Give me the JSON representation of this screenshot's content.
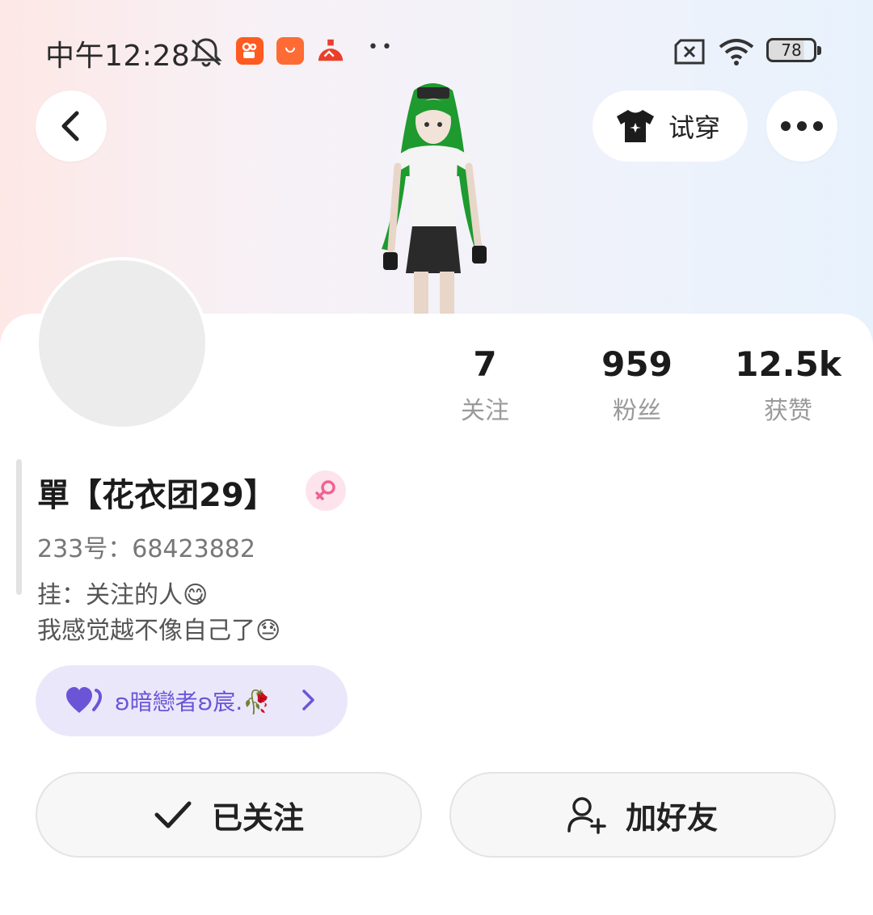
{
  "status_bar": {
    "time": "中午12:28",
    "battery": "78",
    "icons": [
      "mute-bell-icon",
      "kuaishou-app-icon",
      "mi-store-app-icon",
      "fanqie-app-icon",
      "more-dots-icon",
      "sim-off-icon",
      "wifi-icon",
      "battery-icon"
    ]
  },
  "header": {
    "back_icon": "chevron-left-icon",
    "try_on_label": "试穿",
    "more_icon": "more-dots-icon"
  },
  "stats": [
    {
      "value": "7",
      "label": "关注"
    },
    {
      "value": "959",
      "label": "粉丝"
    },
    {
      "value": "12.5k",
      "label": "获赞"
    }
  ],
  "profile": {
    "name": "單【花衣团29】",
    "gender": "female",
    "id_line": "233号：68423882",
    "bio_line1": "挂：关注的人😋",
    "bio_line2": "我感觉越不像自己了😓"
  },
  "cp_badge": {
    "name": "ʚ暗戀者ʚ宸.🥀"
  },
  "actions": {
    "followed_label": "已关注",
    "add_friend_label": "加好友"
  },
  "colors": {
    "accent_purple": "#6b55d6",
    "cp_bg": "#ebe7fb",
    "gender_pink": "#f06292"
  }
}
